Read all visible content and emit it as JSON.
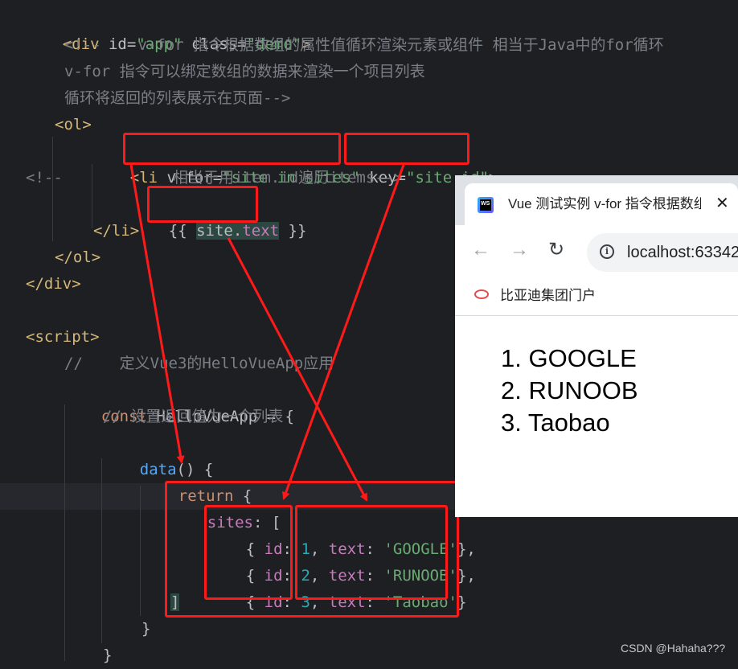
{
  "editor": {
    "lines": {
      "l1": {
        "tag_open": "<div",
        "a1": " id=",
        "v1": "\"app\"",
        "a2": " class=",
        "v2": "\"demo\"",
        "close": ">"
      },
      "l2": "<!--    v-for 指令根据数组的属性值循环渲染元素或组件 相当于Java中的for循环",
      "l3": "v-for 指令可以绑定数组的数据来渲染一个项目列表",
      "l4": "循环将返回的列表展示在页面-->",
      "l5": "<ol>",
      "l6": {
        "tag_open": "<li",
        "a1": " v-for=",
        "v1": "\"site in sites\"",
        "a2": " key=",
        "v2": "\"site.id\"",
        "close": ">"
      },
      "l7": "<!--            相当于用item.id遍历items-->",
      "l8": {
        "open": "{{ ",
        "obj": "site",
        "dot": ".",
        "prop": "text",
        "close": " }}"
      },
      "l9": "</li>",
      "l10": "</ol>",
      "l11": "</div>",
      "l13": "<script>",
      "l14": "//    定义Vue3的HelloVueApp应用",
      "l15": {
        "kw": "const",
        "rest": " HelloVueApp = {"
      },
      "l16": "// 设置返回值为一个列表",
      "l17": {
        "fn": "data",
        "rest": "() {"
      },
      "l18": {
        "kw": "return",
        "rest": " {"
      },
      "l19": {
        "prop": "sites",
        "rest": ": ["
      },
      "rows": [
        {
          "open": "{ ",
          "id_key": "id",
          "sep": ": ",
          "id_val": "1",
          "comma": ", ",
          "text_key": "text",
          "sep2": ": ",
          "text_val": "'GOOGLE'",
          "close": "},"
        },
        {
          "open": "{ ",
          "id_key": "id",
          "sep": ": ",
          "id_val": "2",
          "comma": ", ",
          "text_key": "text",
          "sep2": ": ",
          "text_val": "'RUNOOB'",
          "close": "},"
        },
        {
          "open": "{ ",
          "id_key": "id",
          "sep": ": ",
          "id_val": "3",
          "comma": ", ",
          "text_key": "text",
          "sep2": ": ",
          "text_val": "'Taobao'",
          "close": "}"
        }
      ],
      "l23": "]",
      "l24": "}",
      "l25": "}"
    }
  },
  "browser": {
    "tab_title": "Vue 测试实例 v-for 指令根据数组",
    "tab_icon_text": "WS",
    "close_glyph": "✕",
    "nav": {
      "back": "←",
      "forward": "→",
      "reload": "↻",
      "info": "i"
    },
    "url": "localhost:63342",
    "bookmark": "比亚迪集团门户",
    "list_items": [
      "1. GOOGLE",
      "2. RUNOOB",
      "3. Taobao"
    ]
  },
  "watermark": "CSDN @Hahaha???",
  "colors": {
    "annotation": "#ff1a1a",
    "editor_bg": "#1e1f22"
  }
}
